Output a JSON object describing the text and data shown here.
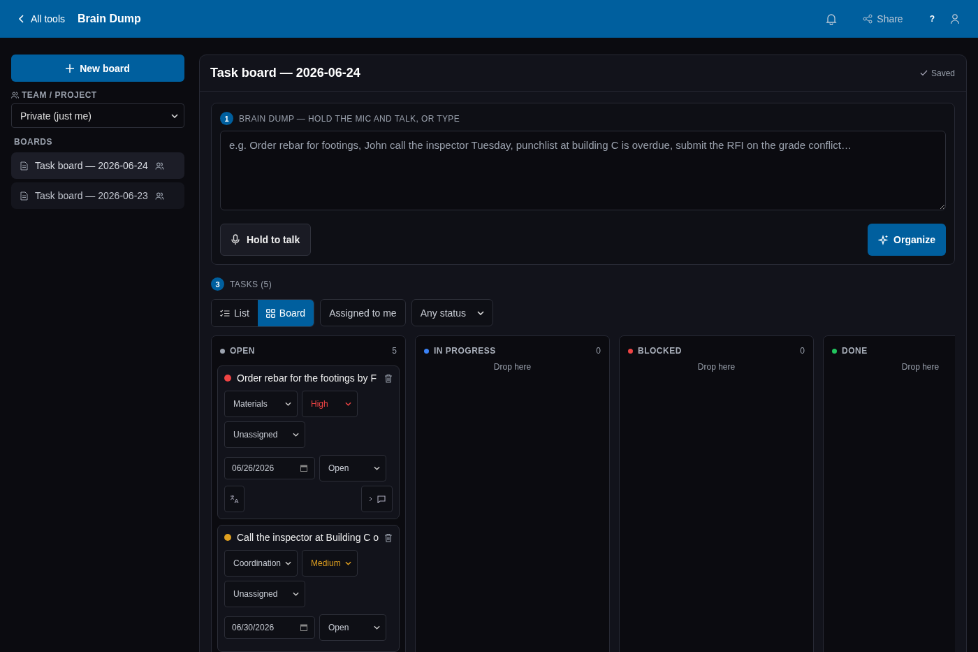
{
  "header": {
    "back": "All tools",
    "title": "Brain Dump",
    "share": "Share",
    "help": "?"
  },
  "sidebar": {
    "new_board": "New board",
    "team_label": "TEAM / PROJECT",
    "team_value": "Private (just me)",
    "boards_label": "BOARDS",
    "boards": [
      {
        "title": "Task board — 2026-06-24",
        "selected": true
      },
      {
        "title": "Task board — 2026-06-23",
        "selected": false
      }
    ]
  },
  "board": {
    "title": "Task board — 2026-06-24",
    "saved": "Saved",
    "dump": {
      "step": "1",
      "label": "BRAIN DUMP — HOLD THE MIC AND TALK, OR TYPE",
      "placeholder": "e.g. Order rebar for footings, John call the inspector Tuesday, punchlist at building C is overdue, submit the RFI on the grade conflict…",
      "talk": "Hold to talk",
      "organize": "Organize"
    },
    "tasks": {
      "step": "3",
      "label": "TASKS (5)",
      "views": [
        {
          "label": "List",
          "kind": "list",
          "selected": false
        },
        {
          "label": "Board",
          "kind": "board",
          "selected": true
        }
      ],
      "assigned": "Assigned to me",
      "status_filter": "Any status",
      "columns": [
        {
          "name": "OPEN",
          "count": "5",
          "color": "#9ca3af",
          "cards": [
            {
              "title": "Order rebar for the footings by F",
              "color": "#ef4444",
              "category": "Materials",
              "priority": "High",
              "assignee": "Unassigned",
              "date": "06/26/2026",
              "status": "Open",
              "actions": true
            },
            {
              "title": "Call the inspector at Building C o",
              "color": "#e0a020",
              "category": "Coordination",
              "priority": "Medium",
              "assignee": "Unassigned",
              "date": "06/30/2026",
              "status": "Open",
              "actions": false
            }
          ]
        },
        {
          "name": "IN PROGRESS",
          "count": "0",
          "color": "#3b82f6",
          "empty": "Drop here"
        },
        {
          "name": "BLOCKED",
          "count": "0",
          "color": "#ef4444",
          "empty": "Drop here"
        },
        {
          "name": "DONE",
          "color": "#22c55e",
          "empty": "Drop here"
        }
      ]
    }
  }
}
